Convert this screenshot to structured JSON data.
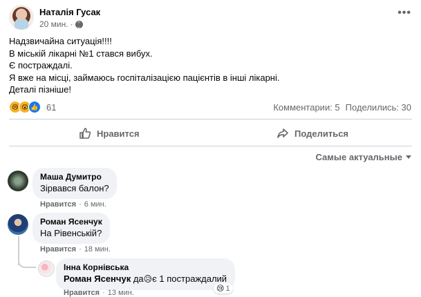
{
  "post": {
    "author": "Наталія Гусак",
    "time": "20 мин.",
    "separator": "·",
    "lines": [
      "Надзвичайна ситуація!!!!",
      "В міській лікарні №1 стався вибух.",
      "Є постраждалі.",
      "Я вже на місці, займаюсь госпіталізацією пацієнтів в інші лікарні.",
      "Деталі пізніше!"
    ],
    "reactions_count": "61",
    "comments_stat": "Комментарии: 5",
    "shares_stat": "Поделились: 30"
  },
  "actions": {
    "like_label": "Нравится",
    "share_label": "Поделиться"
  },
  "sort": {
    "label": "Самые актуальные"
  },
  "comments": [
    {
      "name": "Маша Думитро",
      "text": "Зірвався балон?",
      "like": "Нравится",
      "time": "6 мин."
    },
    {
      "name": "Роман Ясенчук",
      "text": "На Рівенській?",
      "like": "Нравится",
      "time": "18 мин."
    }
  ],
  "reply": {
    "name": "Інна Корнівська",
    "mention": "Роман Ясенчук",
    "text_before": "да",
    "text_after": "є 1 постраждалий",
    "reaction_count": "1",
    "like": "Нравится",
    "time": "13 мин."
  },
  "colors": {
    "brand_blue": "#1877f2",
    "muted": "#65676b",
    "bubble": "#f0f2f5"
  }
}
